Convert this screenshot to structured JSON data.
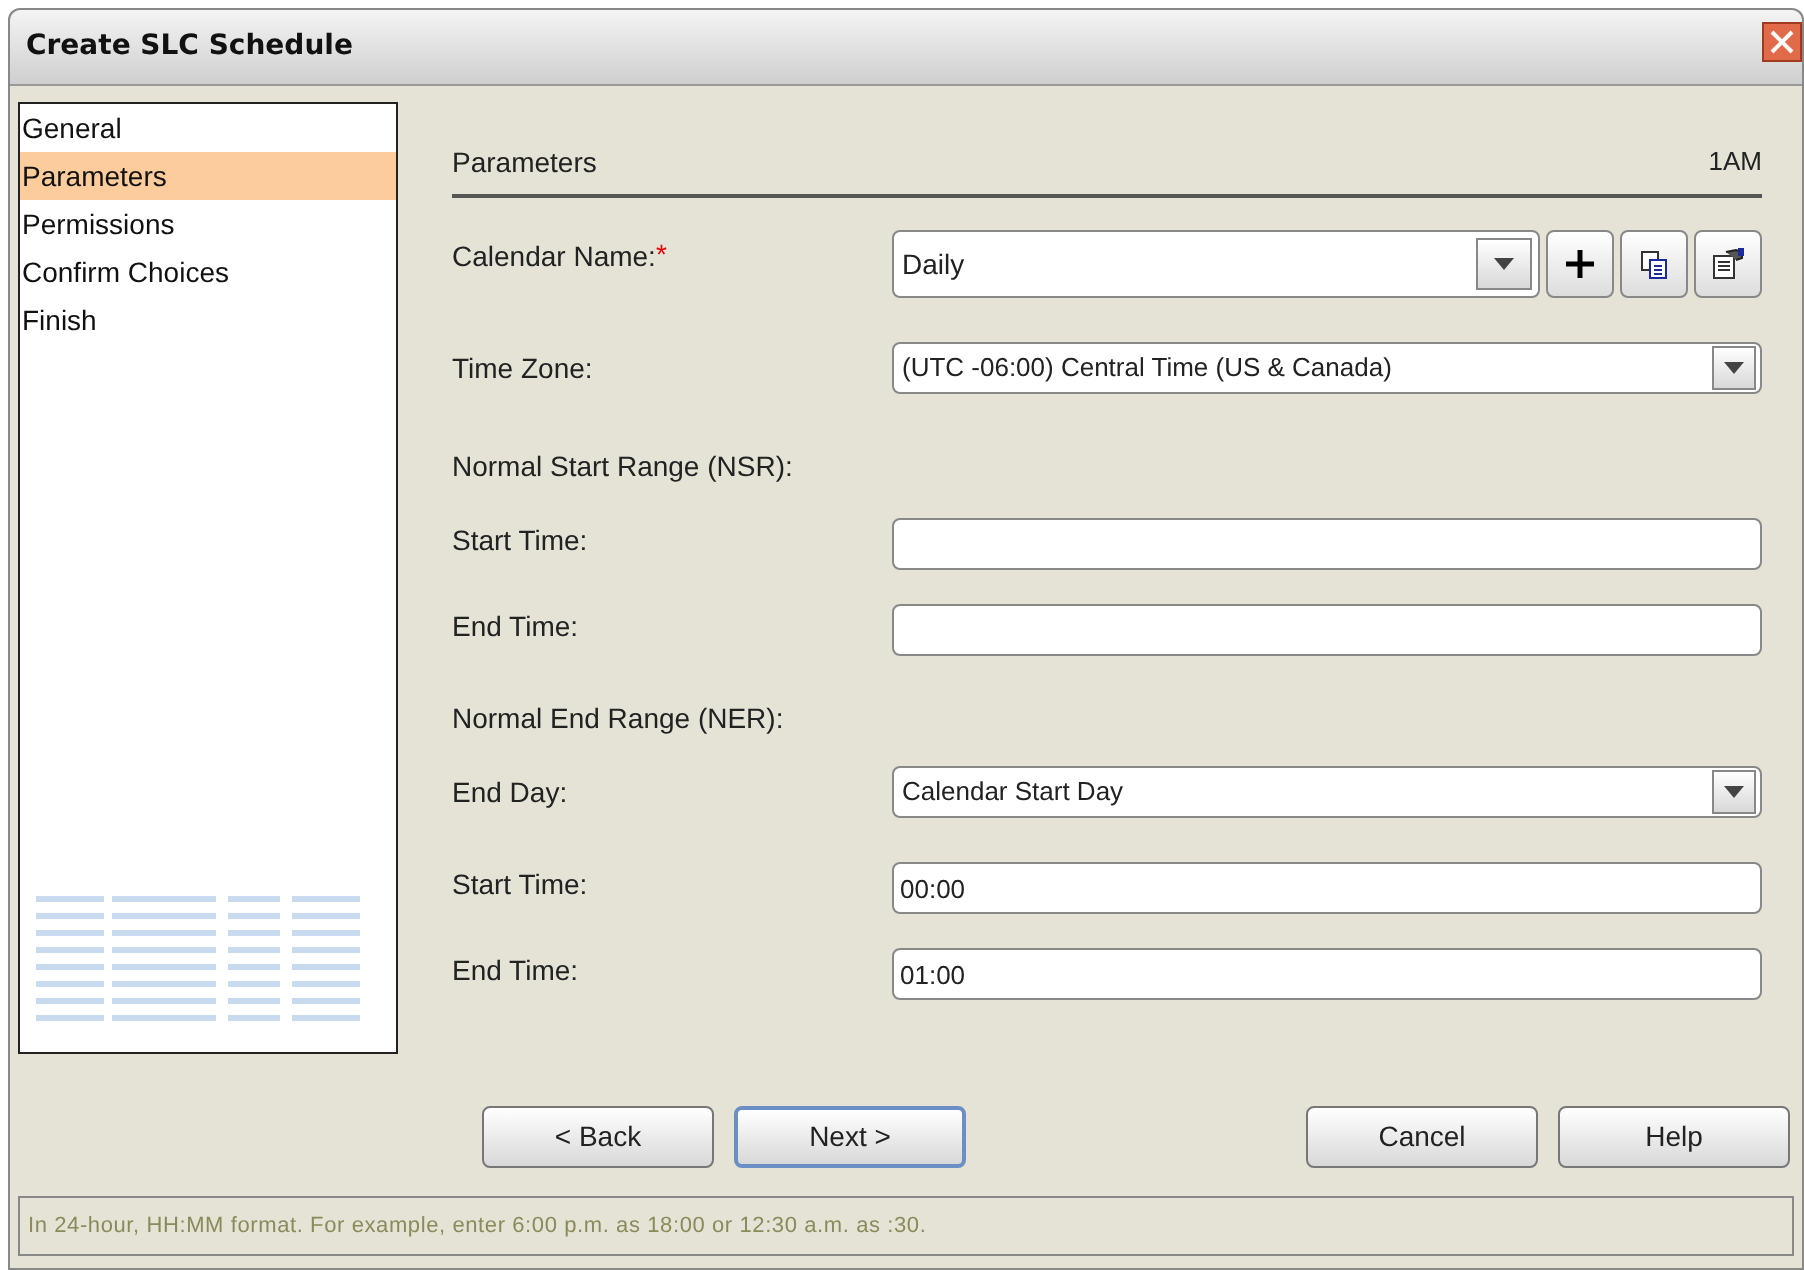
{
  "window": {
    "title": "Create SLC Schedule"
  },
  "sidebar": {
    "items": [
      {
        "label": "General",
        "selected": false
      },
      {
        "label": "Parameters",
        "selected": true
      },
      {
        "label": "Permissions",
        "selected": false
      },
      {
        "label": "Confirm Choices",
        "selected": false
      },
      {
        "label": "Finish",
        "selected": false
      }
    ]
  },
  "panel": {
    "title": "Parameters",
    "tag": "1AM"
  },
  "rows": [
    {
      "kind": "calendar",
      "label": "Calendar Name:",
      "required_mark": "*",
      "value": "Daily"
    },
    {
      "kind": "combo",
      "label": "Time Zone:",
      "value": "(UTC -06:00) Central Time (US & Canada)"
    },
    {
      "kind": "heading",
      "label": "Normal Start Range (NSR):"
    },
    {
      "kind": "input",
      "label": "Start Time:"
    },
    {
      "kind": "input",
      "label": "End Time:"
    },
    {
      "kind": "heading",
      "label": "Normal End Range (NER):"
    },
    {
      "kind": "combo",
      "label": "End Day:",
      "value": "Calendar Start Day"
    },
    {
      "kind": "input",
      "label": "Start Time:",
      "value": "00:00"
    },
    {
      "kind": "input",
      "label": "End Time:",
      "value": "01:00"
    }
  ],
  "buttons": [
    {
      "label": "< Back",
      "focused": false
    },
    {
      "label": "Next >",
      "focused": true
    },
    {
      "label": "Cancel",
      "focused": false
    },
    {
      "label": "Help",
      "focused": false
    }
  ],
  "status_bar": "In 24-hour, HH:MM format. For example, enter 6:00 p.m. as 18:00 or 12:30 a.m. as :30."
}
